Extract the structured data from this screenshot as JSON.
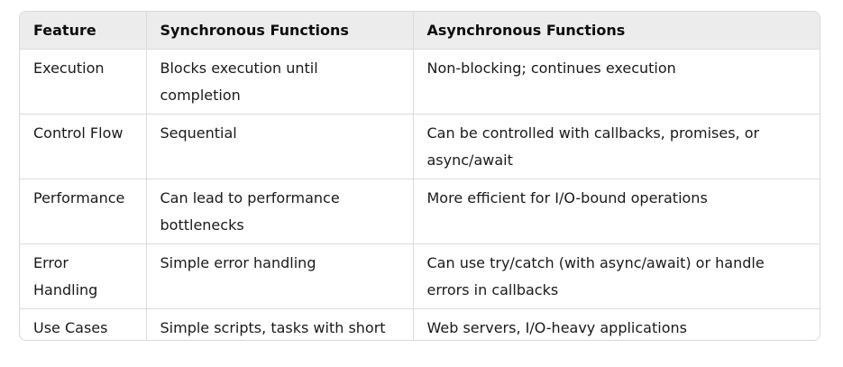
{
  "table": {
    "headers": [
      "Feature",
      "Synchronous Functions",
      "Asynchronous Functions"
    ],
    "rows": [
      [
        "Execution",
        "Blocks execution until completion",
        "Non-blocking; continues execution"
      ],
      [
        "Control Flow",
        "Sequential",
        "Can be controlled with callbacks, promises, or async/await"
      ],
      [
        "Performance",
        "Can lead to performance bottlenecks",
        "More efficient for I/O-bound operations"
      ],
      [
        "Error Handling",
        "Simple error handling",
        "Can use try/catch (with async/await) or handle errors in callbacks"
      ],
      [
        "Use Cases",
        "Simple scripts, tasks with short duration",
        "Web servers, I/O-heavy applications"
      ]
    ]
  }
}
